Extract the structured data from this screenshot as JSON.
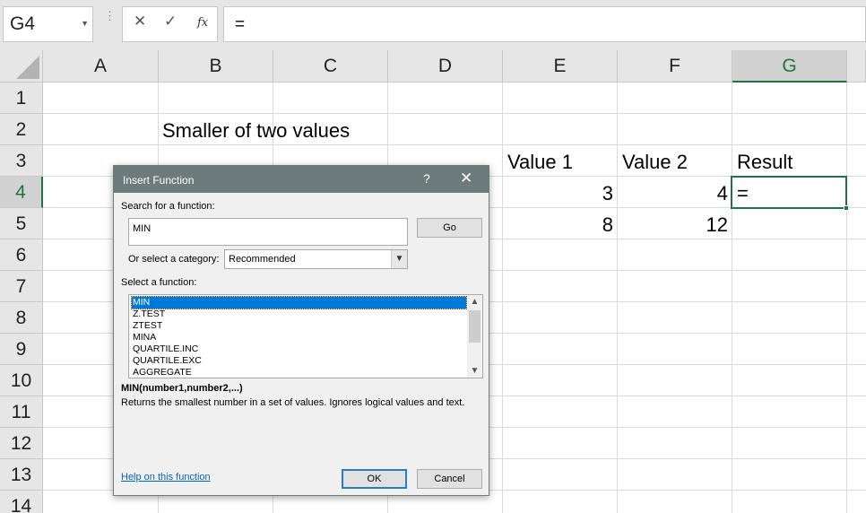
{
  "formula_bar": {
    "name_box": "G4",
    "cancel_glyph": "✕",
    "enter_glyph": "✓",
    "fx_label": "fx",
    "formula": "="
  },
  "columns": [
    "A",
    "B",
    "C",
    "D",
    "E",
    "F",
    "G"
  ],
  "rows": [
    "1",
    "2",
    "3",
    "4",
    "5",
    "6",
    "7",
    "8",
    "9",
    "10",
    "11",
    "12",
    "13",
    "14"
  ],
  "cells": {
    "b2": "Smaller of two values",
    "e3": "Value 1",
    "f3": "Value 2",
    "g3": "Result",
    "e4": "3",
    "f4": "4",
    "g4": "=",
    "e5": "8",
    "f5": "12"
  },
  "dialog": {
    "title": "Insert Function",
    "help_glyph": "?",
    "close_glyph": "✕",
    "search_label": "Search for a function:",
    "search_value": "MIN",
    "go_label": "Go",
    "category_label": "Or select a category:",
    "category_value": "Recommended",
    "select_label": "Select a function:",
    "functions": [
      "MIN",
      "Z.TEST",
      "ZTEST",
      "MINA",
      "QUARTILE.INC",
      "QUARTILE.EXC",
      "AGGREGATE"
    ],
    "selected_index": 0,
    "signature": "MIN(number1,number2,...)",
    "description": "Returns the smallest number in a set of values. Ignores logical values and text.",
    "help_link": "Help on this function",
    "ok_label": "OK",
    "cancel_label": "Cancel"
  },
  "colors": {
    "accent_green": "#217346",
    "dialog_title_bg": "#6e7b7c",
    "selection_blue": "#0078d7",
    "link_blue": "#0563c1"
  }
}
